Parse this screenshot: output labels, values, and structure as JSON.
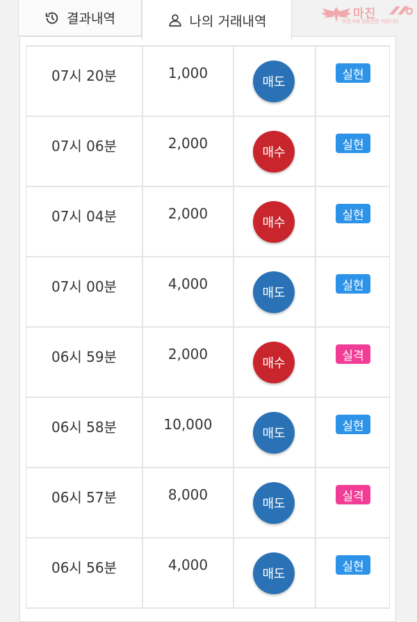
{
  "tabs": {
    "history_label": "결과내역",
    "mine_label": "나의 거래내역"
  },
  "logo": {
    "brand": "마진",
    "tagline": "마진거래 검증전문 커뮤니티"
  },
  "colors": {
    "sell": "#2a72b5",
    "buy": "#c8262c",
    "hit": "#2d93e8",
    "miss": "#f23d97"
  },
  "rows": [
    {
      "time": "07시 20분",
      "amount": "1,000",
      "type": "매도",
      "result": "실현"
    },
    {
      "time": "07시 06분",
      "amount": "2,000",
      "type": "매수",
      "result": "실현"
    },
    {
      "time": "07시 04분",
      "amount": "2,000",
      "type": "매수",
      "result": "실현"
    },
    {
      "time": "07시 00분",
      "amount": "4,000",
      "type": "매도",
      "result": "실현"
    },
    {
      "time": "06시 59분",
      "amount": "2,000",
      "type": "매수",
      "result": "실격"
    },
    {
      "time": "06시 58분",
      "amount": "10,000",
      "type": "매도",
      "result": "실현"
    },
    {
      "time": "06시 57분",
      "amount": "8,000",
      "type": "매도",
      "result": "실격"
    },
    {
      "time": "06시 56분",
      "amount": "4,000",
      "type": "매도",
      "result": "실현"
    }
  ]
}
